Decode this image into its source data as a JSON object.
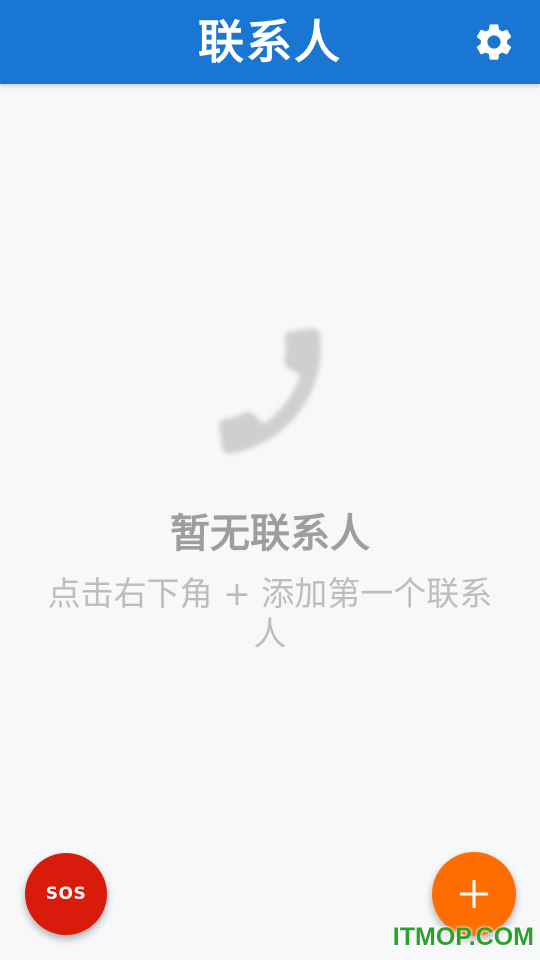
{
  "app_bar": {
    "title": "联系人",
    "background_color": "#1976d2",
    "settings_icon": "gear-icon"
  },
  "empty_state": {
    "icon": "phone-icon",
    "title": "暂无联系人",
    "hint": "点击右下角 + 添加第一个联系人"
  },
  "sos_button": {
    "label": "SOS",
    "color": "#d91b0c"
  },
  "add_button": {
    "icon": "plus-icon",
    "color": "#ff6d00"
  },
  "watermark": {
    "text": "ITMOP.COM"
  }
}
